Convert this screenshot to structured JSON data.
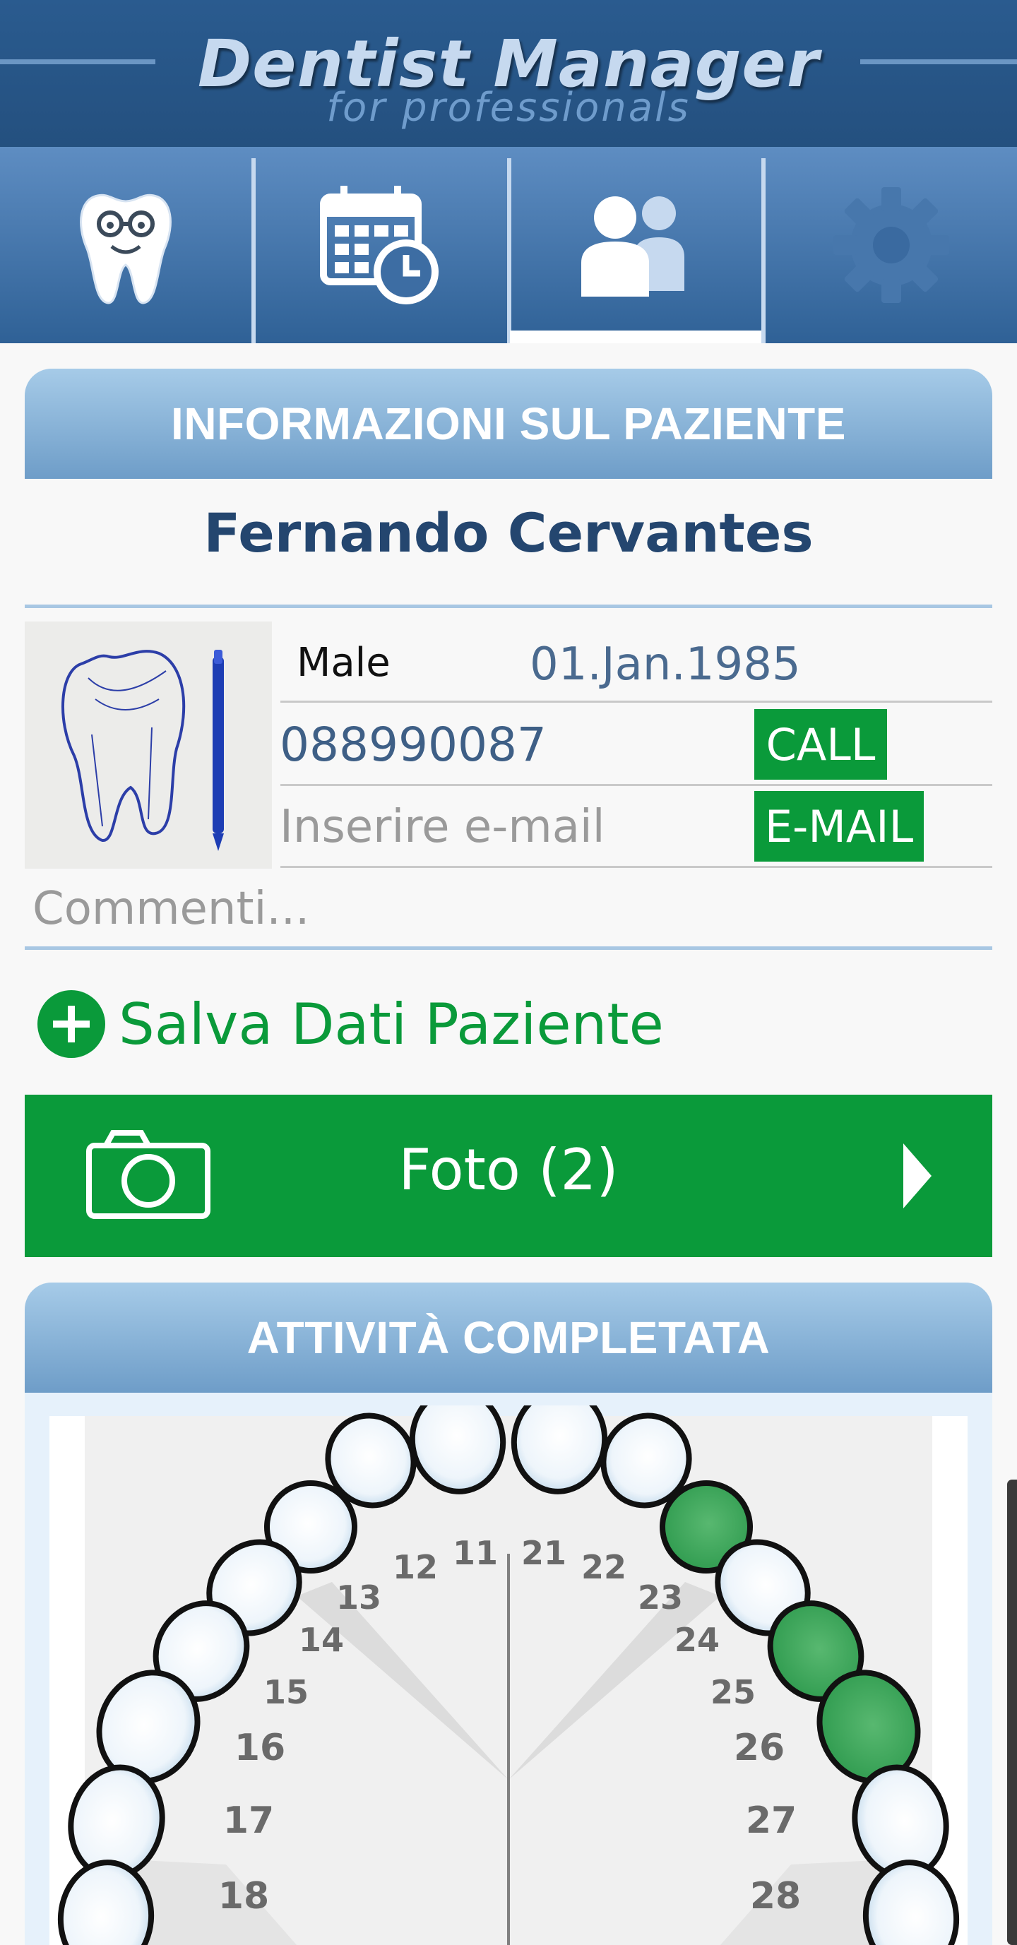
{
  "app": {
    "title": "Dentist Manager",
    "subtitle": "for professionals"
  },
  "tabs": [
    {
      "icon": "tooth-doctor-icon",
      "active": false
    },
    {
      "icon": "calendar-clock-icon",
      "active": false
    },
    {
      "icon": "patients-icon",
      "active": true
    },
    {
      "icon": "gear-icon",
      "active": false
    }
  ],
  "patient_info": {
    "section_title": "INFORMAZIONI SUL PAZIENTE",
    "name": "Fernando Cervantes",
    "gender": "Male",
    "birth_date": "01.Jan.1985",
    "phone": "088990087",
    "call_label": "CALL",
    "email_placeholder": "Inserire e-mail",
    "email_label": "E-MAIL",
    "comments_placeholder": "Commenti..."
  },
  "save": {
    "label": "Salva Dati Paziente"
  },
  "photos": {
    "label": "Foto (2)"
  },
  "activity": {
    "section_title": "ATTIVITÀ COMPLETATA"
  },
  "colors": {
    "header_bg": "#2a5b8f",
    "accent_green": "#0a9a3a",
    "title_blue": "#24466f",
    "completed_tooth": "#3aa657"
  },
  "teeth": {
    "labels": [
      "12",
      "11",
      "21",
      "22",
      "13",
      "23",
      "14",
      "24",
      "15",
      "25",
      "16",
      "26",
      "17",
      "27",
      "18",
      "28"
    ],
    "completed": [
      "23",
      "25",
      "26"
    ]
  }
}
